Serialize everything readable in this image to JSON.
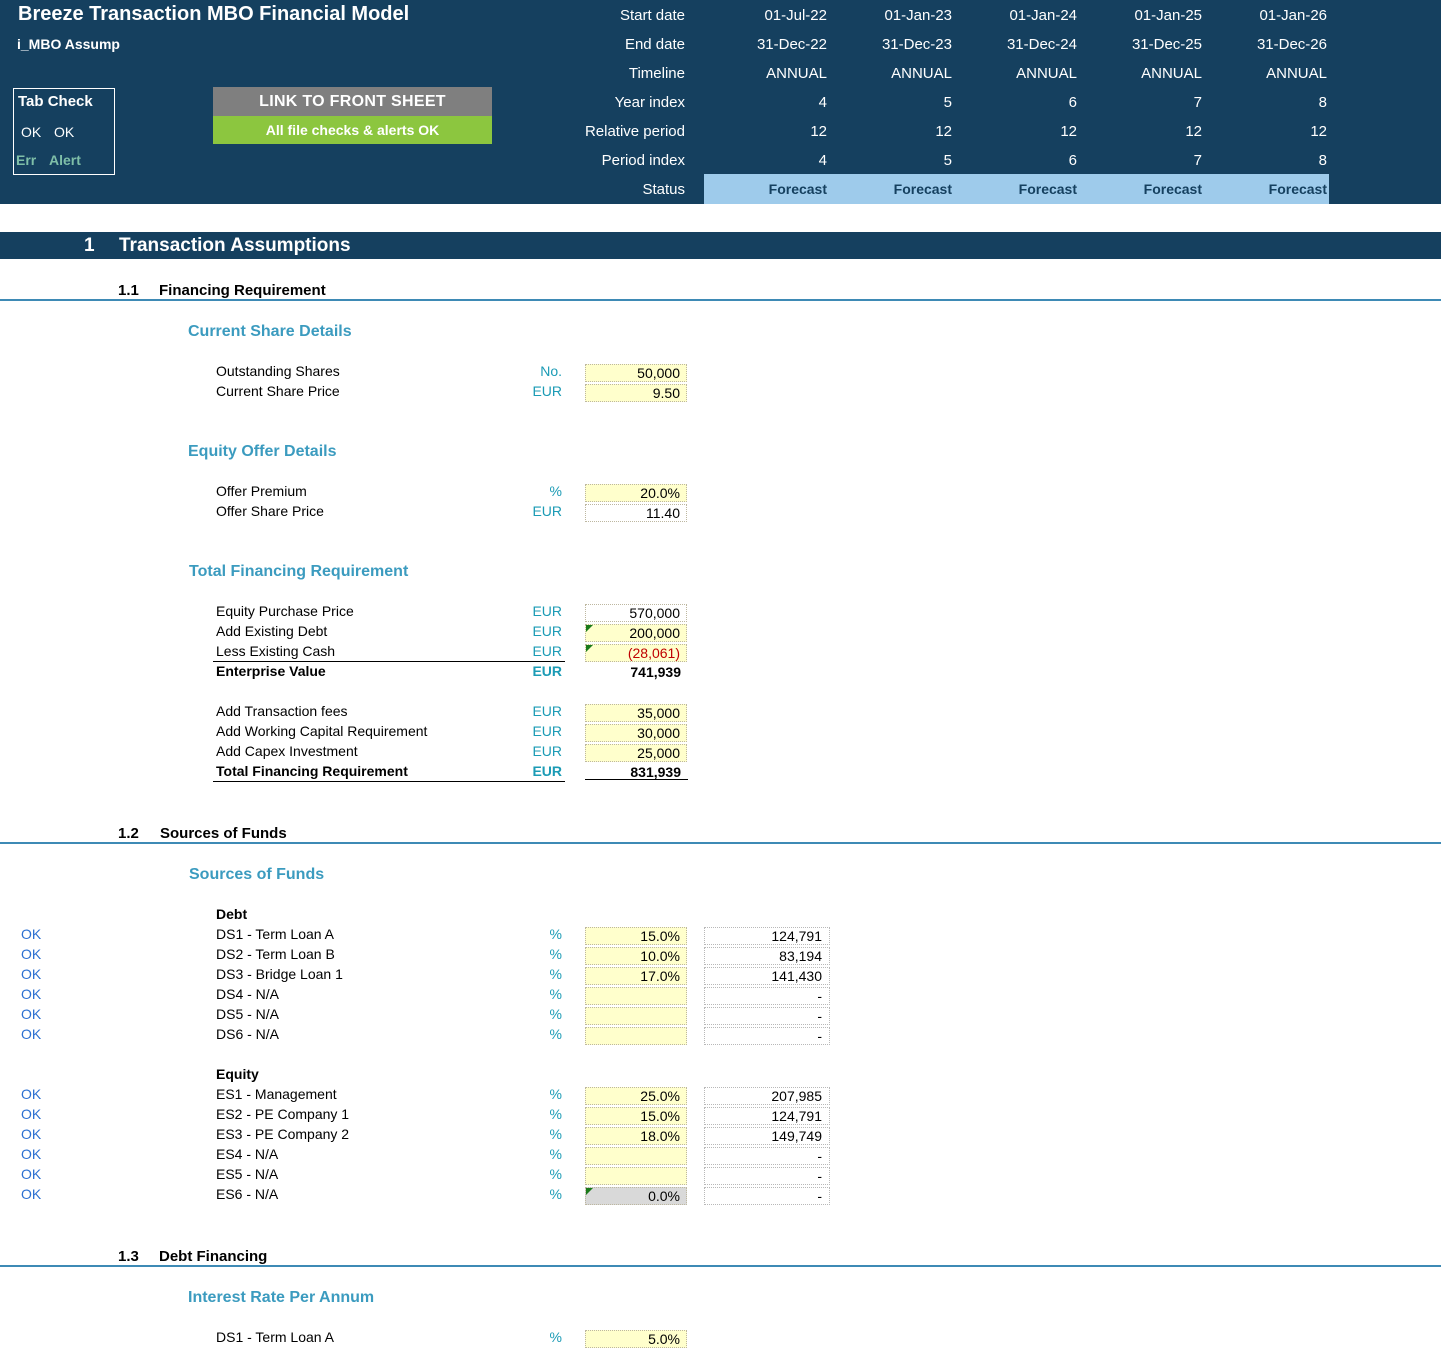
{
  "header": {
    "title": "Breeze Transaction MBO Financial Model",
    "sheet": "i_MBO Assump",
    "tab_check": {
      "title": "Tab Check",
      "ok1": "OK",
      "ok2": "OK",
      "err": "Err",
      "alert": "Alert"
    },
    "link_button": "LINK TO FRONT SHEET",
    "checks_status": "All file checks & alerts OK",
    "timeline_labels": [
      "Start date",
      "End date",
      "Timeline",
      "Year index",
      "Relative period",
      "Period index",
      "Status"
    ],
    "columns": [
      {
        "start": "01-Jul-22",
        "end": "31-Dec-22",
        "timeline": "ANNUAL",
        "year_index": "4",
        "relative_period": "12",
        "period_index": "4",
        "status": "Forecast"
      },
      {
        "start": "01-Jan-23",
        "end": "31-Dec-23",
        "timeline": "ANNUAL",
        "year_index": "5",
        "relative_period": "12",
        "period_index": "5",
        "status": "Forecast"
      },
      {
        "start": "01-Jan-24",
        "end": "31-Dec-24",
        "timeline": "ANNUAL",
        "year_index": "6",
        "relative_period": "12",
        "period_index": "6",
        "status": "Forecast"
      },
      {
        "start": "01-Jan-25",
        "end": "31-Dec-25",
        "timeline": "ANNUAL",
        "year_index": "7",
        "relative_period": "12",
        "period_index": "7",
        "status": "Forecast"
      },
      {
        "start": "01-Jan-26",
        "end": "31-Dec-26",
        "timeline": "ANNUAL",
        "year_index": "8",
        "relative_period": "12",
        "period_index": "8",
        "status": "Forecast"
      }
    ]
  },
  "section1": {
    "num": "1",
    "title": "Transaction Assumptions"
  },
  "s11": {
    "num": "1.1",
    "title": "Financing Requirement",
    "current_share": {
      "heading": "Current Share Details",
      "rows": [
        {
          "label": "Outstanding Shares",
          "unit": "No.",
          "value": "50,000"
        },
        {
          "label": "Current Share Price",
          "unit": "EUR",
          "value": "9.50"
        }
      ]
    },
    "equity_offer": {
      "heading": "Equity Offer Details",
      "rows": [
        {
          "label": "Offer Premium",
          "unit": "%",
          "value": "20.0%"
        },
        {
          "label": "Offer Share Price",
          "unit": "EUR",
          "value": "11.40"
        }
      ]
    },
    "total_financing": {
      "heading": "Total Financing Requirement",
      "rows": [
        {
          "label": "Equity Purchase Price",
          "unit": "EUR",
          "value": "570,000"
        },
        {
          "label": "Add Existing Debt",
          "unit": "EUR",
          "value": "200,000"
        },
        {
          "label": "Less Existing Cash",
          "unit": "EUR",
          "value": "(28,061)"
        },
        {
          "label": "Enterprise Value",
          "unit": "EUR",
          "value": "741,939"
        },
        {
          "label": "Add Transaction fees",
          "unit": "EUR",
          "value": "35,000"
        },
        {
          "label": "Add Working Capital Requirement",
          "unit": "EUR",
          "value": "30,000"
        },
        {
          "label": "Add Capex Investment",
          "unit": "EUR",
          "value": "25,000"
        },
        {
          "label": "Total Financing Requirement",
          "unit": "EUR",
          "value": "831,939"
        }
      ]
    }
  },
  "s12": {
    "num": "1.2",
    "title": "Sources of Funds",
    "heading": "Sources of Funds",
    "debt_label": "Debt",
    "debt": [
      {
        "check": "OK",
        "label": "DS1 - Term Loan A",
        "unit": "%",
        "pct": "15.0%",
        "amount": "124,791"
      },
      {
        "check": "OK",
        "label": "DS2 - Term Loan B",
        "unit": "%",
        "pct": "10.0%",
        "amount": "83,194"
      },
      {
        "check": "OK",
        "label": "DS3 - Bridge Loan 1",
        "unit": "%",
        "pct": "17.0%",
        "amount": "141,430"
      },
      {
        "check": "OK",
        "label": "DS4 - N/A",
        "unit": "%",
        "pct": "",
        "amount": "-"
      },
      {
        "check": "OK",
        "label": "DS5 - N/A",
        "unit": "%",
        "pct": "",
        "amount": "-"
      },
      {
        "check": "OK",
        "label": "DS6 - N/A",
        "unit": "%",
        "pct": "",
        "amount": "-"
      }
    ],
    "equity_label": "Equity",
    "equity": [
      {
        "check": "OK",
        "label": "ES1 - Management",
        "unit": "%",
        "pct": "25.0%",
        "amount": "207,985"
      },
      {
        "check": "OK",
        "label": "ES2 - PE Company 1",
        "unit": "%",
        "pct": "15.0%",
        "amount": "124,791"
      },
      {
        "check": "OK",
        "label": "ES3 - PE Company 2",
        "unit": "%",
        "pct": "18.0%",
        "amount": "149,749"
      },
      {
        "check": "OK",
        "label": "ES4 - N/A",
        "unit": "%",
        "pct": "",
        "amount": "-"
      },
      {
        "check": "OK",
        "label": "ES5 - N/A",
        "unit": "%",
        "pct": "",
        "amount": "-"
      },
      {
        "check": "OK",
        "label": "ES6 - N/A",
        "unit": "%",
        "pct": "0.0%",
        "amount": "-"
      }
    ]
  },
  "s13": {
    "num": "1.3",
    "title": "Debt Financing",
    "heading": "Interest Rate Per Annum",
    "rows": [
      {
        "label": "DS1 - Term Loan A",
        "unit": "%",
        "value": "5.0%"
      }
    ]
  }
}
